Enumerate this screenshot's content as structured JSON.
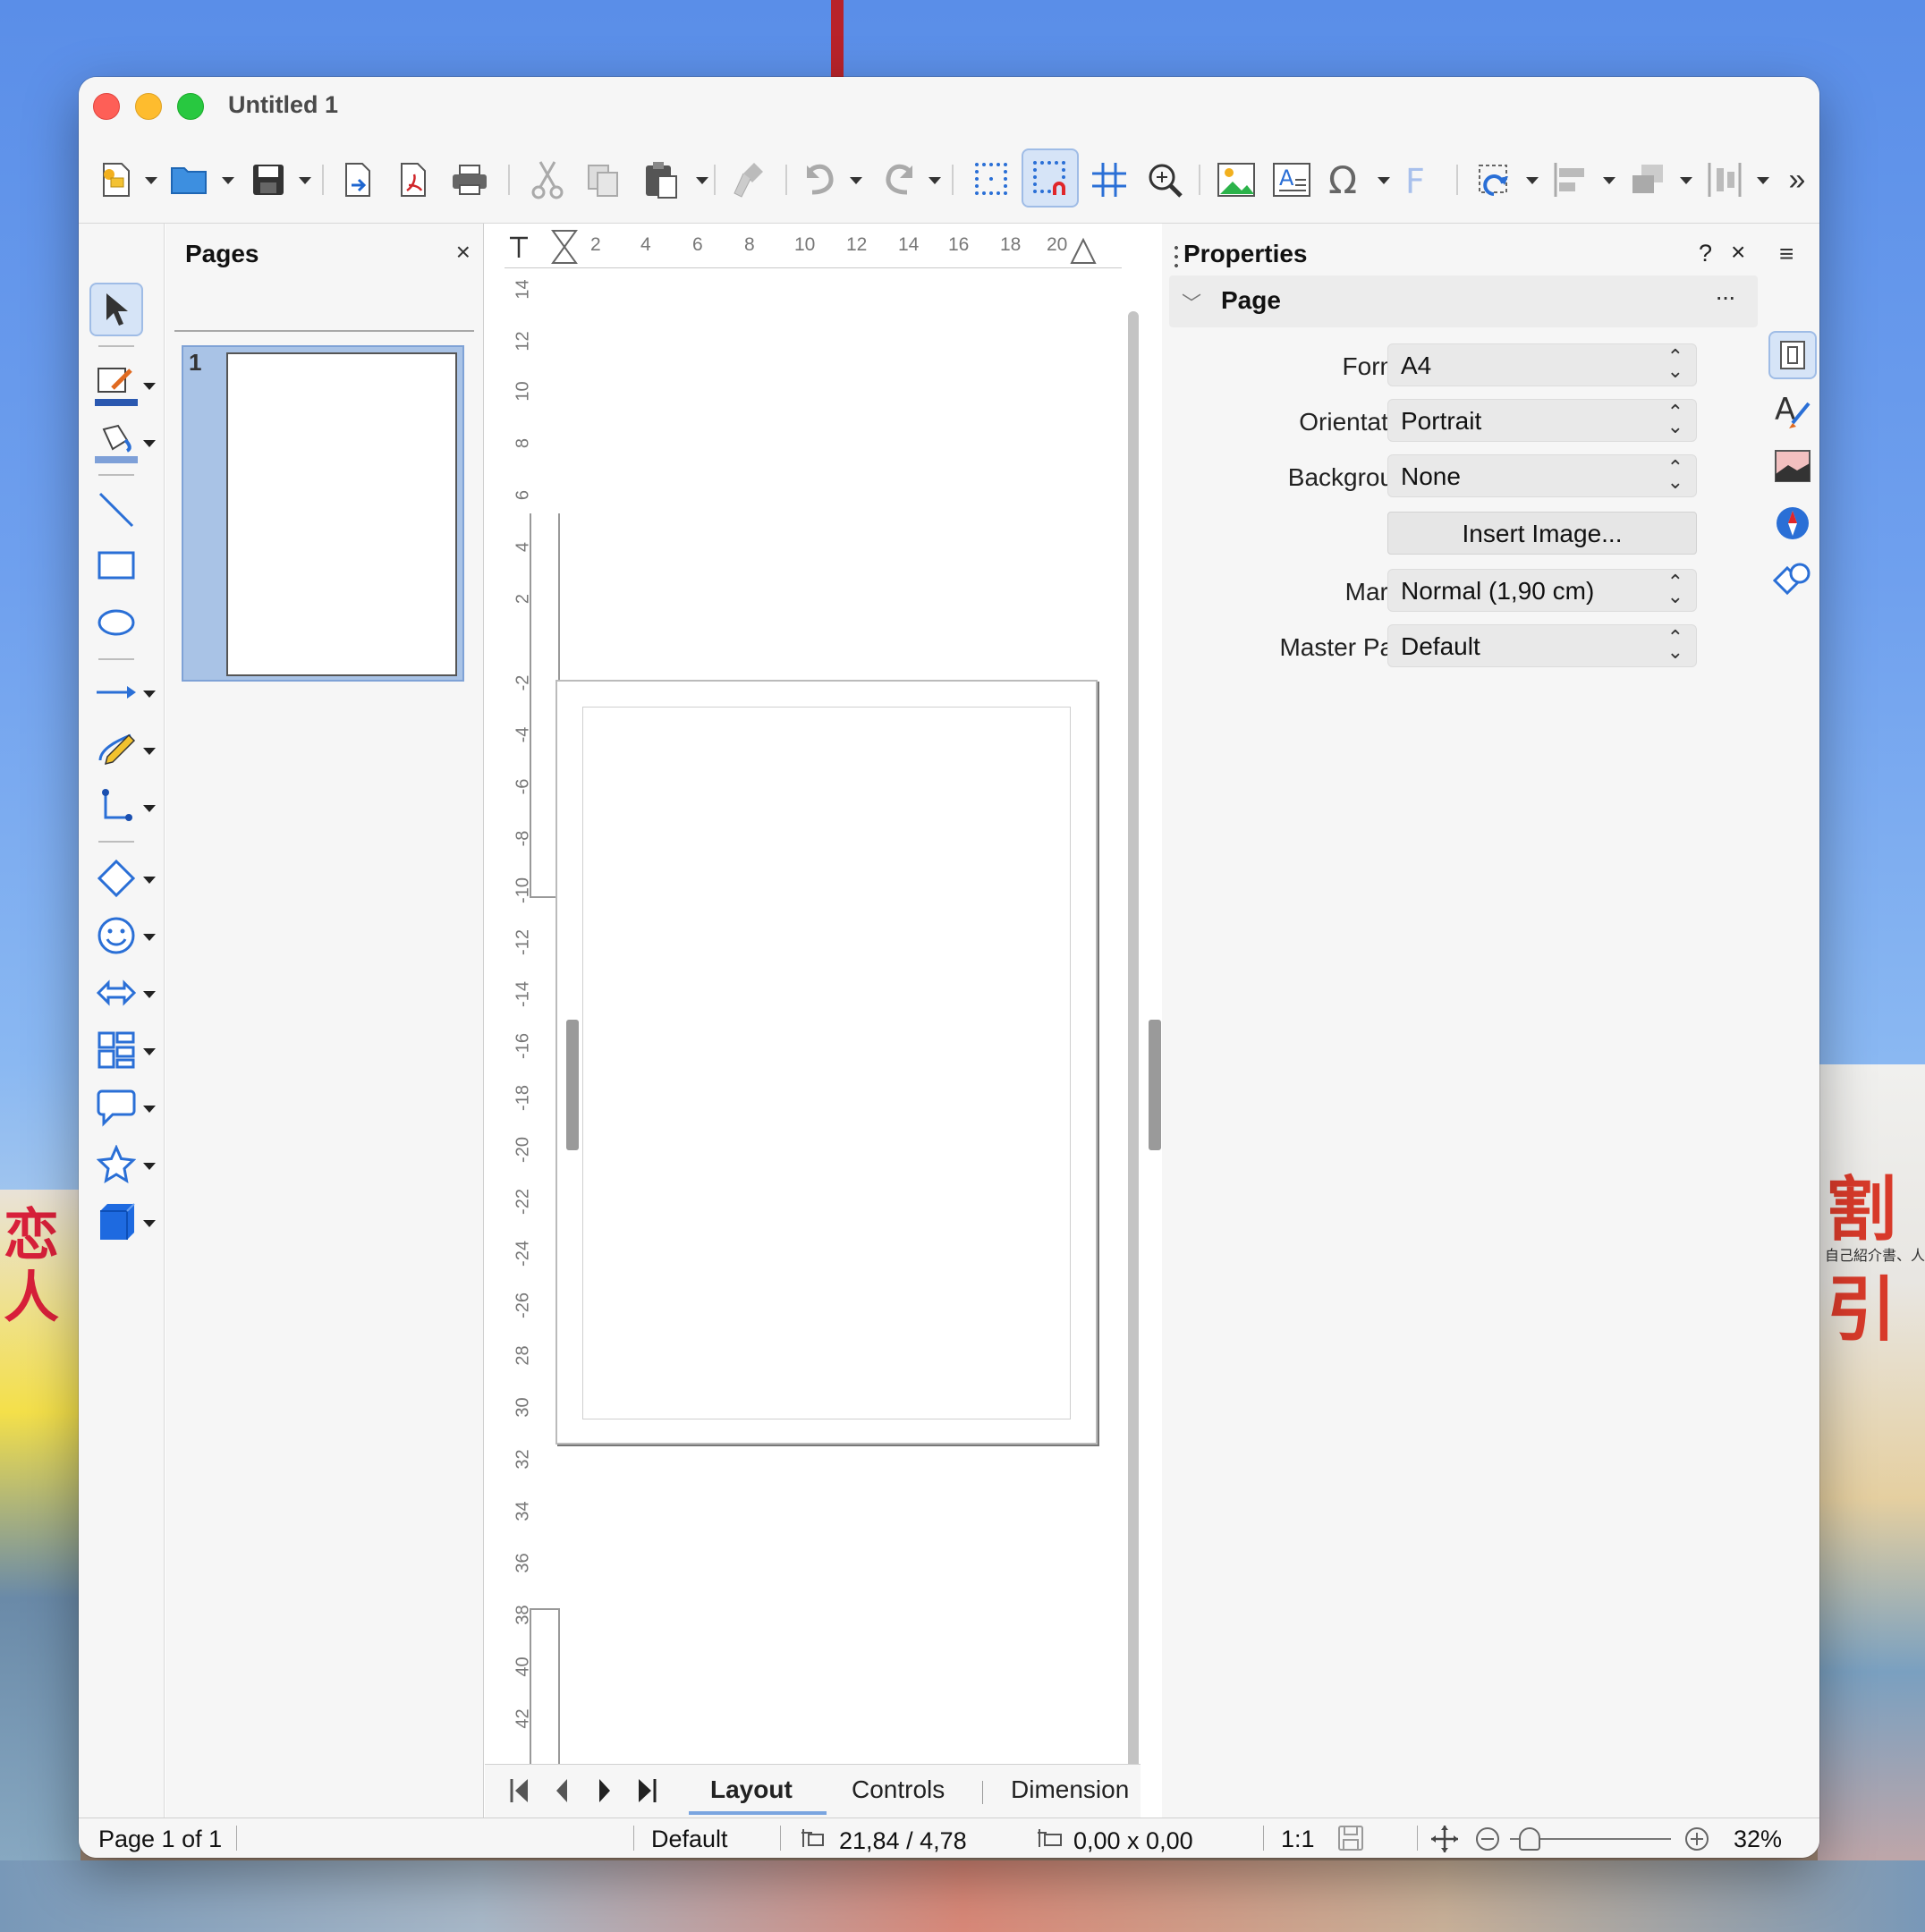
{
  "window": {
    "title": "Untitled 1"
  },
  "toolbar": {
    "icons": [
      "new-icon",
      "open-folder-icon",
      "save-icon",
      "export-icon",
      "export-pdf-icon",
      "print-icon",
      "cut-icon",
      "copy-icon",
      "paste-icon",
      "clone-formatting-icon",
      "undo-icon",
      "redo-icon",
      "display-grid-icon",
      "snap-to-grid-icon",
      "helplines-icon",
      "zoom-pan-icon",
      "insert-image-icon",
      "insert-text-box-icon",
      "special-character-icon",
      "fontwork-icon",
      "transformations-icon",
      "align-objects-icon",
      "arrange-icon",
      "distribute-icon"
    ],
    "overflow": "»"
  },
  "pages_panel": {
    "title": "Pages",
    "close": "×",
    "thumb_number": "1"
  },
  "ruler": {
    "horizontal": [
      "2",
      "4",
      "6",
      "8",
      "10",
      "12",
      "14",
      "16",
      "18",
      "20"
    ],
    "vertical_top": [
      "14",
      "12",
      "10",
      "8",
      "6",
      "4",
      "2"
    ],
    "vertical_page": [
      "2",
      "4",
      "6",
      "8",
      "10",
      "12",
      "14",
      "16",
      "18",
      "20",
      "22",
      "24",
      "26"
    ],
    "vertical_bottom": [
      "28",
      "30",
      "32",
      "34",
      "36",
      "38",
      "40",
      "42"
    ]
  },
  "tabs": {
    "items": [
      "Layout",
      "Controls",
      "Dimension"
    ],
    "active": "Layout"
  },
  "properties": {
    "title": "Properties",
    "help": "?",
    "close": "×",
    "section": "Page",
    "section_more": "···",
    "format_label": "Format:",
    "format_value": "A4",
    "orientation_label": "Orientation:",
    "orientation_value": "Portrait",
    "background_label": "Background:",
    "background_value": "None",
    "insert_image_label": "Insert Image...",
    "margin_label": "Margin:",
    "margin_value": "Normal (1,90 cm)",
    "master_label": "Master Page:",
    "master_value": "Default"
  },
  "deck": {
    "menu": "≡"
  },
  "status": {
    "page": "Page 1 of 1",
    "layout": "Default",
    "position": "21,84 / 4,78",
    "size": "0,00 x 0,00",
    "scale": "1:1",
    "zoom": "32%"
  },
  "background_text": {
    "left_top": "恋",
    "left_bottom": "人",
    "right_big": "割引",
    "right_small": "自己紹介書、人"
  }
}
